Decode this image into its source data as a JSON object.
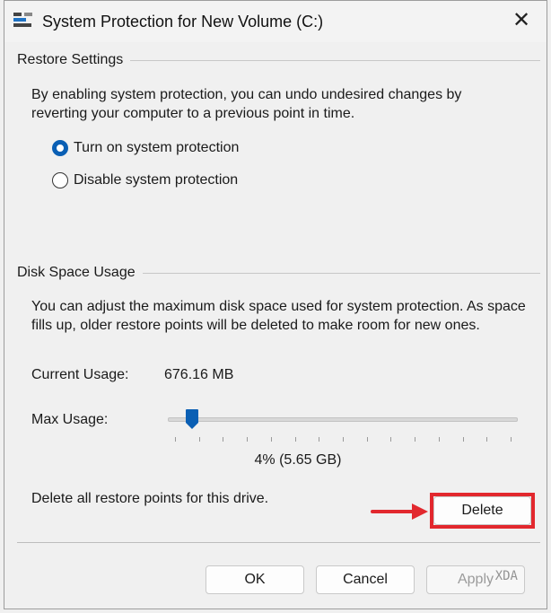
{
  "window": {
    "title": "System Protection for New Volume (C:)",
    "close_glyph": "✕",
    "app_icon": "system-properties-icon"
  },
  "restore_settings": {
    "group_title": "Restore Settings",
    "description_line1": "By enabling system protection, you can undo undesired changes by",
    "description_line2": "reverting your computer to a previous point in time.",
    "options": [
      {
        "label": "Turn on system protection",
        "selected": true
      },
      {
        "label": "Disable system protection",
        "selected": false
      }
    ]
  },
  "disk_space": {
    "group_title": "Disk Space Usage",
    "description_line1": "You can adjust the maximum disk space used for system protection. As space",
    "description_line2": "fills up, older restore points will be deleted to make room for new ones.",
    "current_usage_label": "Current Usage:",
    "current_usage_value": "676.16 MB",
    "max_usage_label": "Max Usage:",
    "max_usage_percent": 4,
    "max_usage_text": "4% (5.65 GB)",
    "delete_text": "Delete all restore points for this drive.",
    "delete_button": "Delete"
  },
  "footer": {
    "ok": "OK",
    "cancel": "Cancel",
    "apply": "Apply"
  },
  "colors": {
    "accent": "#0a5fb4",
    "highlight": "#e2282e"
  },
  "watermark": "XDA"
}
